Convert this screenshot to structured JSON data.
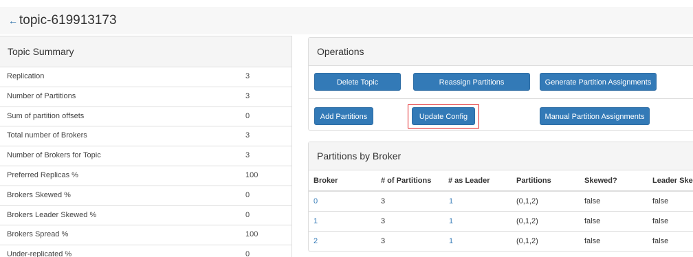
{
  "header": {
    "back_icon": "arrow-left-icon",
    "back_glyph": "←",
    "title": "topic-619913173"
  },
  "summary": {
    "title": "Topic Summary",
    "rows": [
      {
        "label": "Replication",
        "value": "3"
      },
      {
        "label": "Number of Partitions",
        "value": "3"
      },
      {
        "label": "Sum of partition offsets",
        "value": "0"
      },
      {
        "label": "Total number of Brokers",
        "value": "3"
      },
      {
        "label": "Number of Brokers for Topic",
        "value": "3"
      },
      {
        "label": "Preferred Replicas %",
        "value": "100"
      },
      {
        "label": "Brokers Skewed %",
        "value": "0"
      },
      {
        "label": "Brokers Leader Skewed %",
        "value": "0"
      },
      {
        "label": "Brokers Spread %",
        "value": "100"
      },
      {
        "label": "Under-replicated %",
        "value": "0"
      }
    ]
  },
  "operations": {
    "title": "Operations",
    "buttons": {
      "delete_topic": "Delete Topic",
      "reassign_partitions": "Reassign Partitions",
      "generate_assignments": "Generate Partition Assignments",
      "add_partitions": "Add Partitions",
      "update_config": "Update Config",
      "manual_assignments": "Manual Partition Assignments"
    },
    "highlighted": "update_config",
    "highlight_color": "#e0191b",
    "button_color": "#337ab7"
  },
  "partitions_by_broker": {
    "title": "Partitions by Broker",
    "columns": [
      "Broker",
      "# of Partitions",
      "# as Leader",
      "Partitions",
      "Skewed?",
      "Leader Ske"
    ],
    "rows": [
      {
        "broker": "0",
        "num_partitions": "3",
        "as_leader": "1",
        "partitions": "(0,1,2)",
        "skewed": "false",
        "leader_skewed": "false"
      },
      {
        "broker": "1",
        "num_partitions": "3",
        "as_leader": "1",
        "partitions": "(0,1,2)",
        "skewed": "false",
        "leader_skewed": "false"
      },
      {
        "broker": "2",
        "num_partitions": "3",
        "as_leader": "1",
        "partitions": "(0,1,2)",
        "skewed": "false",
        "leader_skewed": "false"
      }
    ]
  }
}
